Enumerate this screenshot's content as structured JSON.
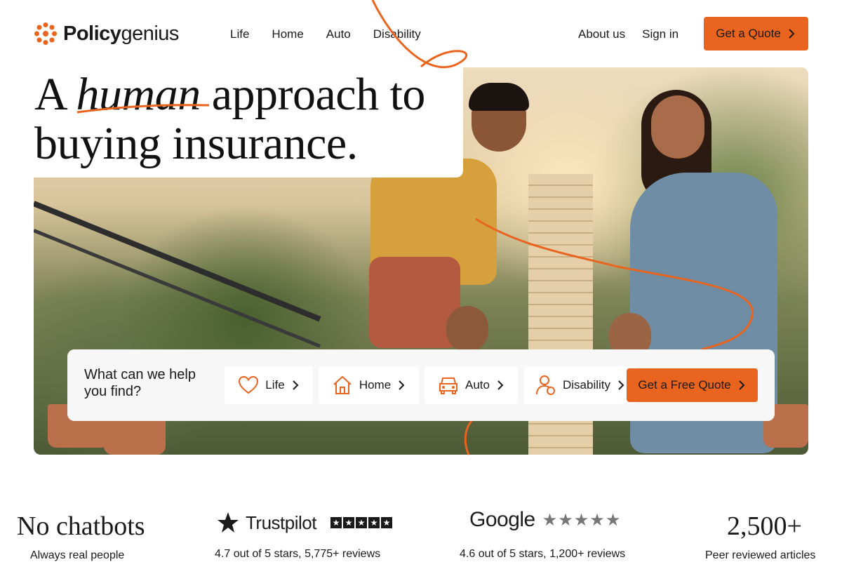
{
  "brand": {
    "name_bold": "Policy",
    "name_light": "genius",
    "accent": "#e8641f"
  },
  "nav": {
    "items": [
      "Life",
      "Home",
      "Auto",
      "Disability"
    ]
  },
  "header_right": {
    "about": "About us",
    "signin": "Sign in",
    "cta": "Get a Quote"
  },
  "hero": {
    "headline_1": "A",
    "headline_em": "human",
    "headline_2": "approach to",
    "headline_3": "buying insurance."
  },
  "finder": {
    "question": "What can we help you find?",
    "options": [
      {
        "label": "Life",
        "icon": "heart-icon"
      },
      {
        "label": "Home",
        "icon": "house-icon"
      },
      {
        "label": "Auto",
        "icon": "car-icon"
      },
      {
        "label": "Disability",
        "icon": "person-icon"
      }
    ],
    "cta": "Get a Free Quote"
  },
  "stats": [
    {
      "big": "No chatbots",
      "sub": "Always real people"
    },
    {
      "brand": "Trustpilot",
      "sub": "4.7 out of 5 stars, 5,775+ reviews"
    },
    {
      "brand": "Google",
      "sub": "4.6 out of 5 stars, 1,200+ reviews"
    },
    {
      "big": "2,500+",
      "sub": "Peer reviewed articles"
    }
  ]
}
